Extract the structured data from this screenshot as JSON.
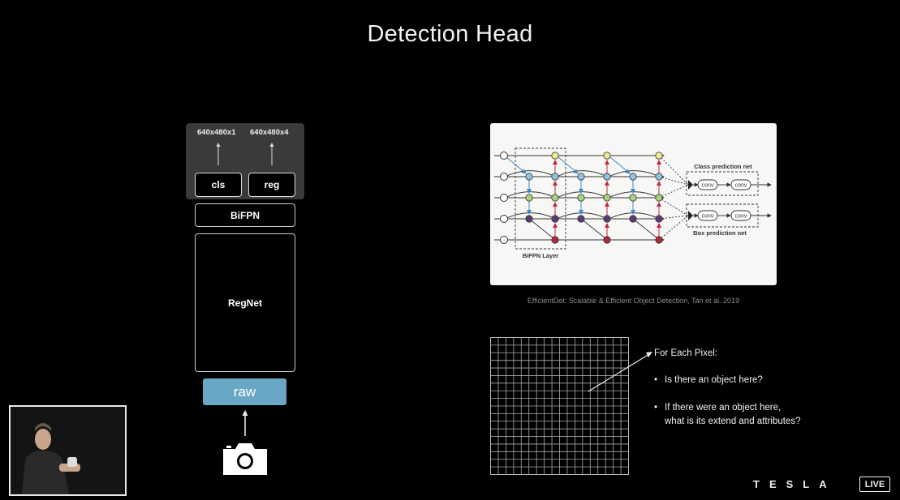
{
  "slide": {
    "title": "Detection Head"
  },
  "architecture": {
    "outputs": [
      {
        "shape": "640x480x1",
        "head": "cls"
      },
      {
        "shape": "640x480x4",
        "head": "reg"
      }
    ],
    "neck": "BiFPN",
    "backbone": "RegNet",
    "input": "raw",
    "camera_icon": "camera-icon"
  },
  "figure": {
    "labels": {
      "class_net": "Class prediction net",
      "box_net": "Box prediction net",
      "bifpn_layer": "BiFPN Layer",
      "conv": "conv"
    },
    "caption": "EfficientDet: Scalable & Efficient Object Detection, Tan et al. 2019"
  },
  "pixel_info": {
    "heading": "For Each Pixel:",
    "bullets": [
      "Is there an object here?",
      "If there were an object here,",
      "what is its extend and attributes?"
    ]
  },
  "footer": {
    "brand": "TESLA",
    "live_badge": "LIVE"
  },
  "colors": {
    "raw_box": "#6aa7c4",
    "node_yellow": "#f1ef8f",
    "node_blue": "#8fc4e0",
    "node_green": "#a9d37f",
    "node_purple": "#5e3a78",
    "node_red": "#b0283a"
  }
}
